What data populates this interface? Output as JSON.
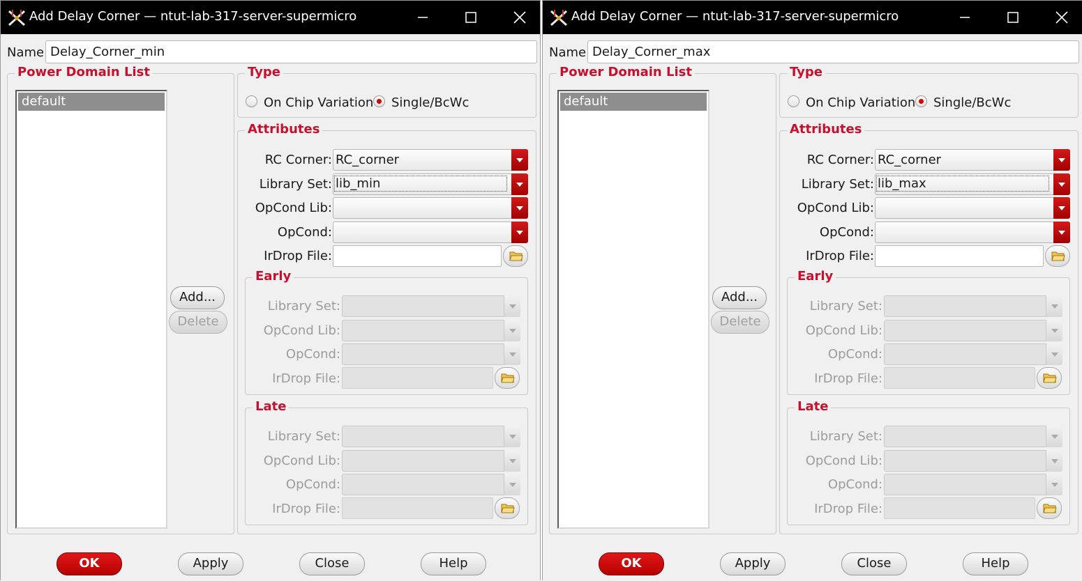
{
  "windows": [
    {
      "title": "Add Delay Corner — ntut-lab-317-server-supermicro",
      "name_label": "Name:",
      "name_value": "Delay_Corner_min",
      "power_domain_title": "Power Domain List",
      "power_domains": [
        "default"
      ],
      "add_label": "Add...",
      "delete_label": "Delete",
      "type_title": "Type",
      "type_options": [
        "On Chip Variation",
        "Single/BcWc"
      ],
      "type_selected": "Single/BcWc",
      "attributes_title": "Attributes",
      "rc_corner_label": "RC Corner:",
      "rc_corner_value": "RC_corner",
      "library_set_label": "Library Set:",
      "library_set_value": "lib_min",
      "opcond_lib_label": "OpCond Lib:",
      "opcond_lib_value": "",
      "opcond_label": "OpCond:",
      "opcond_value": "",
      "irdrop_label": "IrDrop File:",
      "irdrop_value": "",
      "early": {
        "title": "Early",
        "library_set_label": "Library Set:",
        "opcond_lib_label": "OpCond Lib:",
        "opcond_label": "OpCond:",
        "irdrop_label": "IrDrop File:"
      },
      "late": {
        "title": "Late",
        "library_set_label": "Library Set:",
        "opcond_lib_label": "OpCond Lib:",
        "opcond_label": "OpCond:",
        "irdrop_label": "IrDrop File:"
      },
      "buttons": {
        "ok": "OK",
        "apply": "Apply",
        "close": "Close",
        "help": "Help"
      }
    },
    {
      "title": "Add Delay Corner — ntut-lab-317-server-supermicro",
      "name_label": "Name:",
      "name_value": "Delay_Corner_max",
      "power_domain_title": "Power Domain List",
      "power_domains": [
        "default"
      ],
      "add_label": "Add...",
      "delete_label": "Delete",
      "type_title": "Type",
      "type_options": [
        "On Chip Variation",
        "Single/BcWc"
      ],
      "type_selected": "Single/BcWc",
      "attributes_title": "Attributes",
      "rc_corner_label": "RC Corner:",
      "rc_corner_value": "RC_corner",
      "library_set_label": "Library Set:",
      "library_set_value": "lib_max",
      "opcond_lib_label": "OpCond Lib:",
      "opcond_lib_value": "",
      "opcond_label": "OpCond:",
      "opcond_value": "",
      "irdrop_label": "IrDrop File:",
      "irdrop_value": "",
      "early": {
        "title": "Early",
        "library_set_label": "Library Set:",
        "opcond_lib_label": "OpCond Lib:",
        "opcond_label": "OpCond:",
        "irdrop_label": "IrDrop File:"
      },
      "late": {
        "title": "Late",
        "library_set_label": "Library Set:",
        "opcond_lib_label": "OpCond Lib:",
        "opcond_label": "OpCond:",
        "irdrop_label": "IrDrop File:"
      },
      "buttons": {
        "ok": "OK",
        "apply": "Apply",
        "close": "Close",
        "help": "Help"
      }
    }
  ],
  "colors": {
    "accent": "#c8102e",
    "titlebar": "#000000",
    "ok_button": "#cc0000",
    "dialog_bg": "#f0f0f0"
  },
  "icons": [
    "app-icon",
    "minimize-icon",
    "maximize-icon",
    "close-icon",
    "folder-icon",
    "chevron-down-icon",
    "radio-icon"
  ]
}
